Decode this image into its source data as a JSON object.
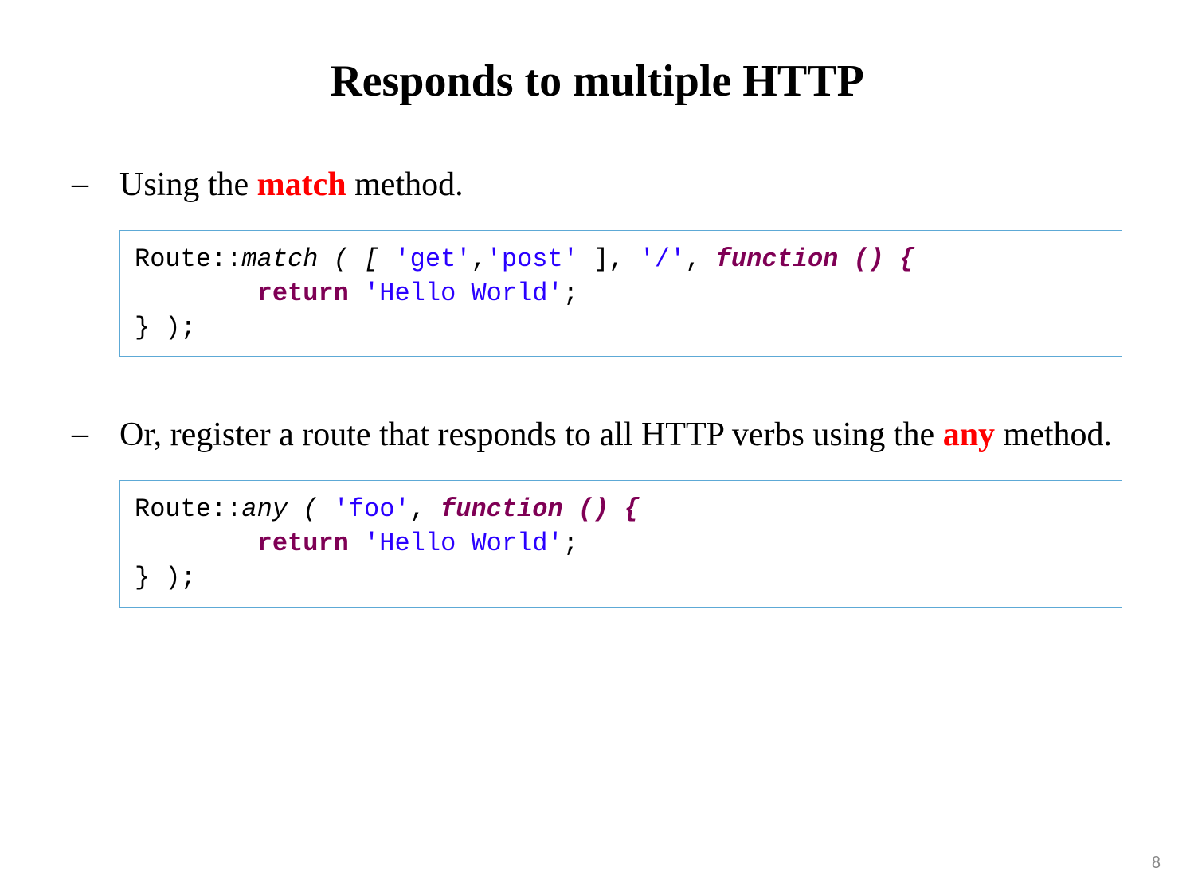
{
  "title": "Responds to multiple HTTP",
  "bullet1": {
    "pre": "Using the ",
    "kw": "match",
    "post": " method."
  },
  "code1": {
    "l1_a": "Route::",
    "l1_b": "match",
    "l1_c": " ( [ ",
    "l1_d": "'get'",
    "l1_e": ",",
    "l1_f": "'post'",
    "l1_g": " ], ",
    "l1_h": "'/'",
    "l1_i": ", ",
    "l1_j": "function",
    "l1_k": " () {",
    "l2_a": "\treturn",
    "l2_b": " ",
    "l2_c": "'Hello World'",
    "l2_d": ";",
    "l3_a": "} );"
  },
  "bullet2": {
    "pre": "Or, register a route that responds to all HTTP verbs using the ",
    "kw": "any",
    "post": " method."
  },
  "code2": {
    "l1_a": "Route::",
    "l1_b": "any",
    "l1_c": " ( ",
    "l1_d": "'foo'",
    "l1_e": ", ",
    "l1_f": "function",
    "l1_g": " () {",
    "l2_a": "\treturn",
    "l2_b": " ",
    "l2_c": "'Hello World'",
    "l2_d": ";",
    "l3_a": "} );"
  },
  "page_number": "8"
}
